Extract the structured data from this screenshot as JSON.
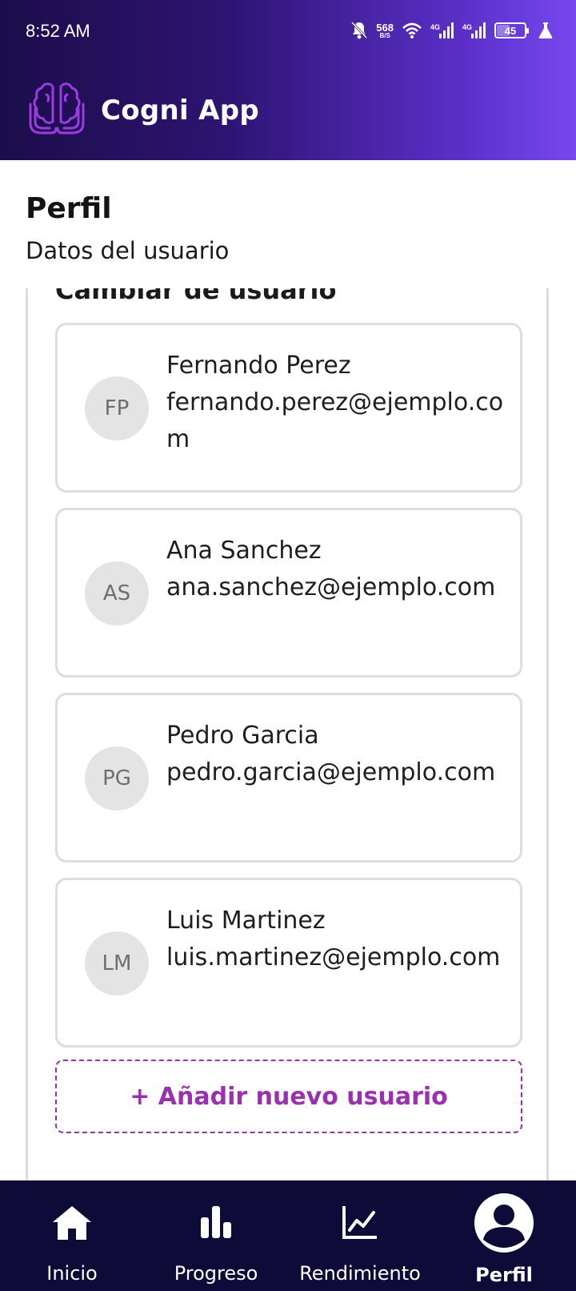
{
  "status_bar": {
    "time": "8:52 AM",
    "net_speed_value": "568",
    "net_speed_unit": "B/S",
    "signal1_label": "4G",
    "signal2_label": "4G",
    "battery": "45",
    "icons": [
      "bell-off-icon",
      "wifi-icon",
      "signal-icon",
      "signal-icon",
      "battery-icon",
      "flask-icon"
    ]
  },
  "header": {
    "app_title": "Cogni App",
    "logo_icon": "brain-hands-logo"
  },
  "page": {
    "title": "Perfil",
    "subtitle": "Datos del usuario"
  },
  "switch_user": {
    "title": "Cambiar de usuario",
    "users": [
      {
        "initials": "FP",
        "name": "Fernando Perez",
        "email": "fernando.perez@ejemplo.com"
      },
      {
        "initials": "AS",
        "name": "Ana Sanchez",
        "email": "ana.sanchez@ejemplo.com"
      },
      {
        "initials": "PG",
        "name": "Pedro Garcia",
        "email": "pedro.garcia@ejemplo.com"
      },
      {
        "initials": "LM",
        "name": "Luis Martinez",
        "email": "luis.martinez@ejemplo.com"
      }
    ],
    "add_button": "+ Añadir nuevo usuario"
  },
  "bottom_nav": {
    "items": [
      {
        "label": "Inicio",
        "icon": "home-icon"
      },
      {
        "label": "Progreso",
        "icon": "bar-chart-icon"
      },
      {
        "label": "Rendimiento",
        "icon": "line-chart-icon"
      },
      {
        "label": "Perfil",
        "icon": "profile-icon"
      }
    ],
    "active": "Perfil"
  },
  "colors": {
    "header_start": "#1b0d4a",
    "header_end": "#7648ee",
    "accent": "#9a2fb0",
    "nav_background": "#0f0b38",
    "logo": "#9b3be0"
  }
}
